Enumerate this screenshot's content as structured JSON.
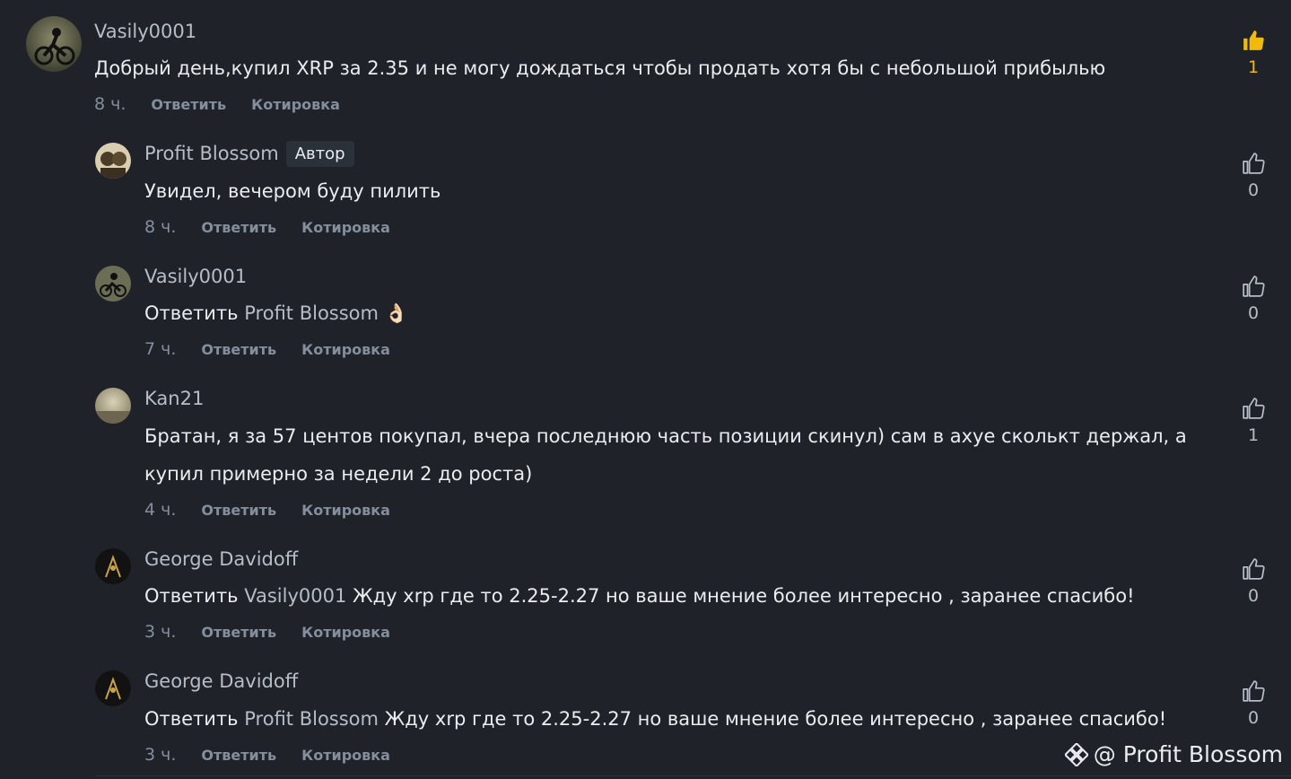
{
  "comments": [
    {
      "author": "Vasily0001",
      "text": "Добрый день,купил XRP за 2.35 и не могу дождаться чтобы продать хотя бы с небольшой прибылью",
      "time": "8 ч.",
      "reply_label": "Ответить",
      "quote_label": "Котировка",
      "likes": "1",
      "liked": true
    },
    {
      "author": "Profit Blossom",
      "badge": "Автор",
      "text": "Увидел, вечером буду пилить",
      "time": "8 ч.",
      "reply_label": "Ответить",
      "quote_label": "Котировка",
      "likes": "0"
    },
    {
      "author": "Vasily0001",
      "reply_prefix": "Ответить",
      "mention": "Profit Blossom",
      "text": "👌🏻",
      "time": "7 ч.",
      "reply_label": "Ответить",
      "quote_label": "Котировка",
      "likes": "0"
    },
    {
      "author": "Kan21",
      "text_line1": "Братан, я за 57 центов покупал, вчера последнюю часть позиции скинул) сам в ахуе сколькт держал, а",
      "text_line2": "купил примерно за недели 2 до роста)",
      "time": "4 ч.",
      "reply_label": "Ответить",
      "quote_label": "Котировка",
      "likes": "1"
    },
    {
      "author": "George Davidoff",
      "reply_prefix": "Ответить",
      "mention": "Vasily0001",
      "text": "Жду xrp где то 2.25-2.27 но ваше мнение более интересно , заранее спасибо!",
      "time": "3 ч.",
      "reply_label": "Ответить",
      "quote_label": "Котировка",
      "likes": "0"
    },
    {
      "author": "George Davidoff",
      "reply_prefix": "Ответить",
      "mention": "Profit Blossom",
      "text": "Жду xrp где то 2.25-2.27 но ваше мнение более интересно , заранее спасибо!",
      "time": "3 ч.",
      "reply_label": "Ответить",
      "quote_label": "Котировка",
      "likes": "0"
    }
  ],
  "watermark": "@ Profit Blossom",
  "icons": {
    "like": "thumbs-up-icon",
    "watermark": "binance-square-logo-icon",
    "avatar": "user-avatar"
  },
  "colors": {
    "background": "#1f2329",
    "liked": "#f0b90b",
    "muted": "#848e9c",
    "text": "#eaecef"
  }
}
